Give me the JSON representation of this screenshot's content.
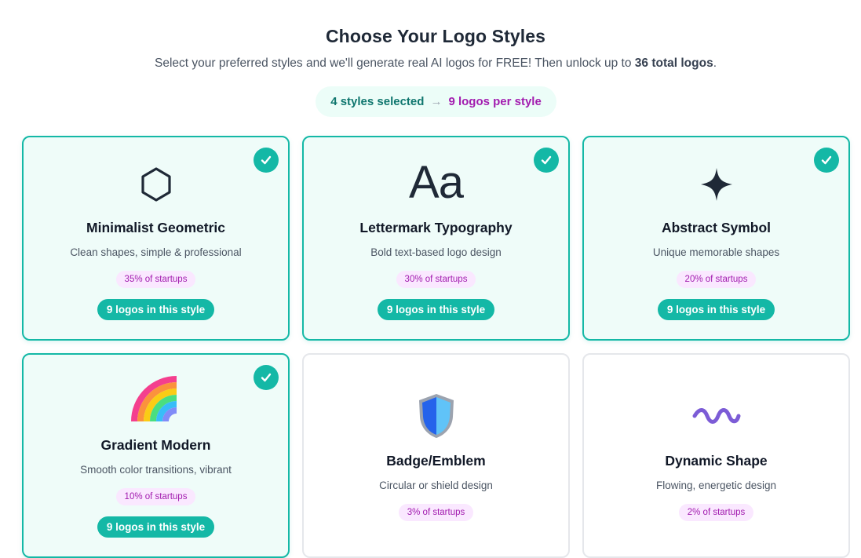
{
  "header": {
    "title": "Choose Your Logo Styles",
    "subtitle_pre": "Select your preferred styles and we'll generate real AI logos for FREE! Then unlock up to ",
    "subtitle_bold": "36 total logos",
    "subtitle_post": "."
  },
  "summary": {
    "selected": "4 styles selected",
    "arrow": "→",
    "per_style": "9 logos per style"
  },
  "colors": {
    "accent": "#14b8a6",
    "selected_bg": "#effcf9",
    "badge_bg": "#fae8ff",
    "badge_text": "#a21caf"
  },
  "styles": [
    {
      "name": "Minimalist Geometric",
      "description": "Clean shapes, simple & professional",
      "share": "35% of startups",
      "count": "9 logos in this style",
      "selected": true,
      "icon": "hexagon-icon"
    },
    {
      "name": "Lettermark Typography",
      "description": "Bold text-based logo design",
      "share": "30% of startups",
      "count": "9 logos in this style",
      "selected": true,
      "icon": "Aa"
    },
    {
      "name": "Abstract Symbol",
      "description": "Unique memorable shapes",
      "share": "20% of startups",
      "count": "9 logos in this style",
      "selected": true,
      "icon": "four-point-star-icon"
    },
    {
      "name": "Gradient Modern",
      "description": "Smooth color transitions, vibrant",
      "share": "10% of startups",
      "count": "9 logos in this style",
      "selected": true,
      "icon": "rainbow-icon"
    },
    {
      "name": "Badge/Emblem",
      "description": "Circular or shield design",
      "share": "3% of startups",
      "count": "",
      "selected": false,
      "icon": "shield-icon"
    },
    {
      "name": "Dynamic Shape",
      "description": "Flowing, energetic design",
      "share": "2% of startups",
      "count": "",
      "selected": false,
      "icon": "wave-icon"
    }
  ]
}
